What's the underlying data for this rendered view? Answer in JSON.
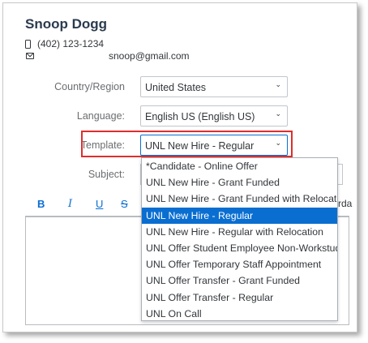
{
  "contact": {
    "name": "Snoop Dogg",
    "phone": "(402) 123-1234",
    "email": "snoop@gmail.com"
  },
  "form": {
    "country_label": "Country/Region",
    "country_value": "United States",
    "language_label": "Language:",
    "language_value": "English US (English US)",
    "template_label": "Template:",
    "template_value": "UNL New Hire - Regular",
    "subject_label": "Subject:"
  },
  "toolbar": {
    "bold": "B",
    "italic": "I",
    "underline": "U",
    "strike": "S",
    "overflow_text": "rda"
  },
  "template_options": [
    "*Candidate - Online Offer",
    "UNL New Hire - Grant Funded",
    "UNL New Hire - Grant Funded with Relocation",
    "UNL New Hire - Regular",
    "UNL New Hire - Regular with Relocation",
    "UNL Offer Student Employee Non-Workstudy",
    "UNL Offer Temporary Staff Appointment",
    "UNL Offer Transfer - Grant Funded",
    "UNL Offer Transfer - Regular",
    "UNL On Call"
  ],
  "selected_option_index": 3,
  "colors": {
    "accent": "#0a6ed1",
    "highlight_border": "#e02d2d"
  }
}
